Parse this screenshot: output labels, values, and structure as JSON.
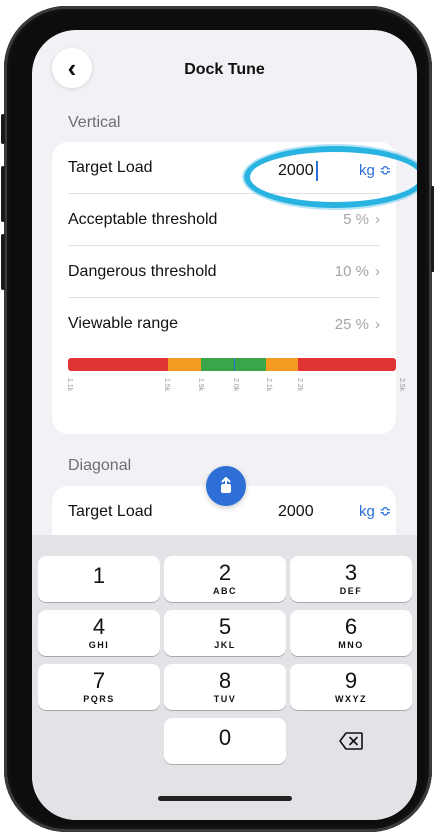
{
  "nav": {
    "title": "Dock Tune"
  },
  "vertical": {
    "section_label": "Vertical",
    "target_load_label": "Target Load",
    "target_load_value": "2000",
    "unit": "kg ≎",
    "rows": [
      {
        "label": "Acceptable threshold",
        "value": "5 %"
      },
      {
        "label": "Dangerous threshold",
        "value": "10 %"
      },
      {
        "label": "Viewable range",
        "value": "25 %"
      }
    ],
    "range_ticks": [
      "1.1k",
      "1.5k",
      "1.9k",
      "2.0k",
      "2.1k",
      "2.2k",
      "2.5k"
    ]
  },
  "diagonal": {
    "section_label": "Diagonal",
    "target_load_label": "Target Load",
    "target_load_value": "2000",
    "unit": "kg ≎"
  },
  "keypad": {
    "keys": [
      {
        "num": "1",
        "letters": ""
      },
      {
        "num": "2",
        "letters": "ABC"
      },
      {
        "num": "3",
        "letters": "DEF"
      },
      {
        "num": "4",
        "letters": "GHI"
      },
      {
        "num": "5",
        "letters": "JKL"
      },
      {
        "num": "6",
        "letters": "MNO"
      },
      {
        "num": "7",
        "letters": "PQRS"
      },
      {
        "num": "8",
        "letters": "TUV"
      },
      {
        "num": "9",
        "letters": "WXYZ"
      },
      {
        "num": "0",
        "letters": ""
      }
    ]
  },
  "colors": {
    "accent": "#2d6fd6",
    "highlight": "#29b3e1",
    "danger": "#e03434",
    "warning": "#f49b22",
    "ok": "#38a649"
  },
  "icons": {
    "back": "chevron-left-icon",
    "share": "share-icon",
    "chevron": "chevron-right-icon",
    "delete": "backspace-icon"
  }
}
